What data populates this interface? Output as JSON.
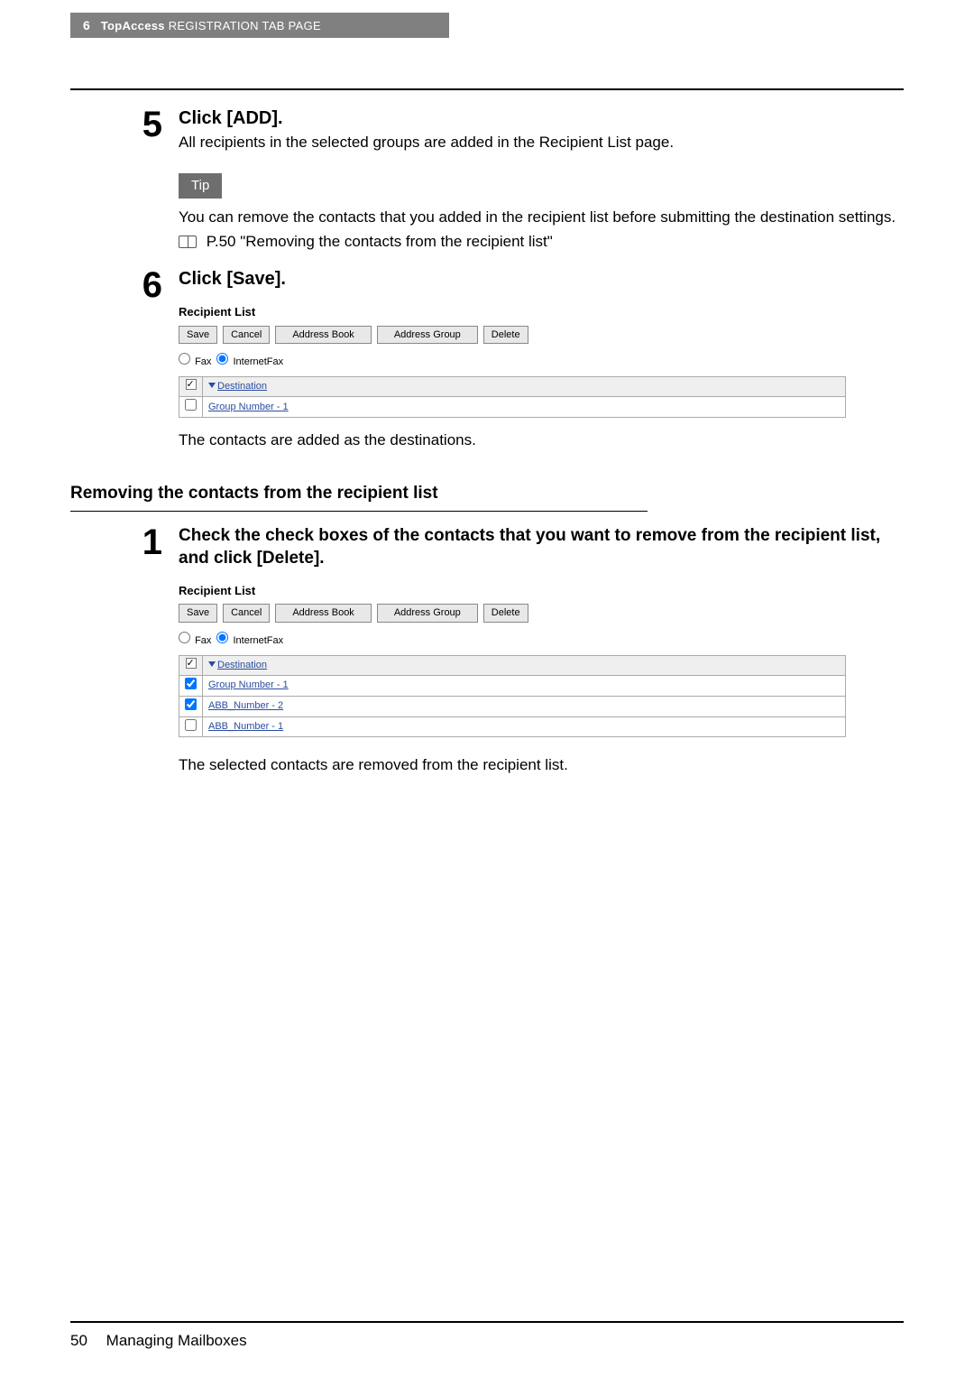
{
  "header": {
    "chapter_num": "6",
    "chapter_title_prefix": "TopAccess",
    "chapter_title_rest": "REGISTRATION TAB PAGE"
  },
  "step5": {
    "num": "5",
    "title": "Click [ADD].",
    "desc": "All recipients in the selected groups are added in the Recipient List page.",
    "tip_label": "Tip",
    "tip_text": "You can remove the contacts that you added in the recipient list before submitting the destination settings.",
    "book_ref": "P.50 \"Removing the contacts from the recipient list\""
  },
  "step6": {
    "num": "6",
    "title": "Click [Save].",
    "result": "The contacts are added as the destinations."
  },
  "rl1": {
    "title": "Recipient List",
    "buttons": {
      "save": "Save",
      "cancel": "Cancel",
      "addr_book": "Address Book",
      "addr_group": "Address Group",
      "delete": "Delete"
    },
    "radios": {
      "fax": "Fax",
      "internetfax": "InternetFax"
    },
    "header": "Destination",
    "rows": [
      {
        "checked": false,
        "label": "Group Number - 1"
      }
    ]
  },
  "section_heading": "Removing the contacts from the recipient list",
  "step_r1": {
    "num": "1",
    "title": "Check the check boxes of the contacts that you want to remove from the recipient list, and click [Delete].",
    "result": "The selected contacts are removed from the recipient list."
  },
  "rl2": {
    "title": "Recipient List",
    "buttons": {
      "save": "Save",
      "cancel": "Cancel",
      "addr_book": "Address Book",
      "addr_group": "Address Group",
      "delete": "Delete"
    },
    "radios": {
      "fax": "Fax",
      "internetfax": "InternetFax"
    },
    "header": "Destination",
    "rows": [
      {
        "checked": true,
        "label": "Group Number - 1"
      },
      {
        "checked": true,
        "label": "ABB_Number - 2"
      },
      {
        "checked": false,
        "label": "ABB_Number - 1"
      }
    ]
  },
  "footer": {
    "page_num": "50",
    "section": "Managing Mailboxes"
  }
}
